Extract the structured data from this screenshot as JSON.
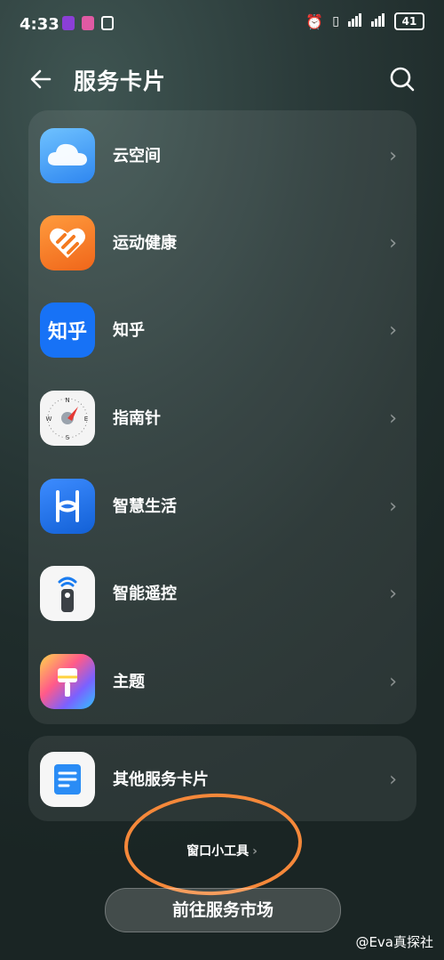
{
  "status_bar": {
    "time": "4:33",
    "battery": "41"
  },
  "header": {
    "title": "服务卡片"
  },
  "items": [
    {
      "label": "云空间"
    },
    {
      "label": "运动健康"
    },
    {
      "label": "知乎",
      "icon_text": "知乎"
    },
    {
      "label": "指南针",
      "compass": [
        "N",
        "E",
        "S",
        "W"
      ]
    },
    {
      "label": "智慧生活"
    },
    {
      "label": "智能遥控"
    },
    {
      "label": "主题"
    }
  ],
  "other": {
    "label": "其他服务卡片"
  },
  "widgets_link": {
    "label": "窗口小工具"
  },
  "market_button": {
    "label": "前往服务市场"
  },
  "watermark": "@Eva真探社",
  "colors": {
    "annotation_oval": "#f5883a",
    "cloud_icon": "#2e86f0",
    "health_icon": "#f47a20",
    "zhihu_icon": "#1772f6",
    "smart_life_icon": "#1a73e8"
  }
}
